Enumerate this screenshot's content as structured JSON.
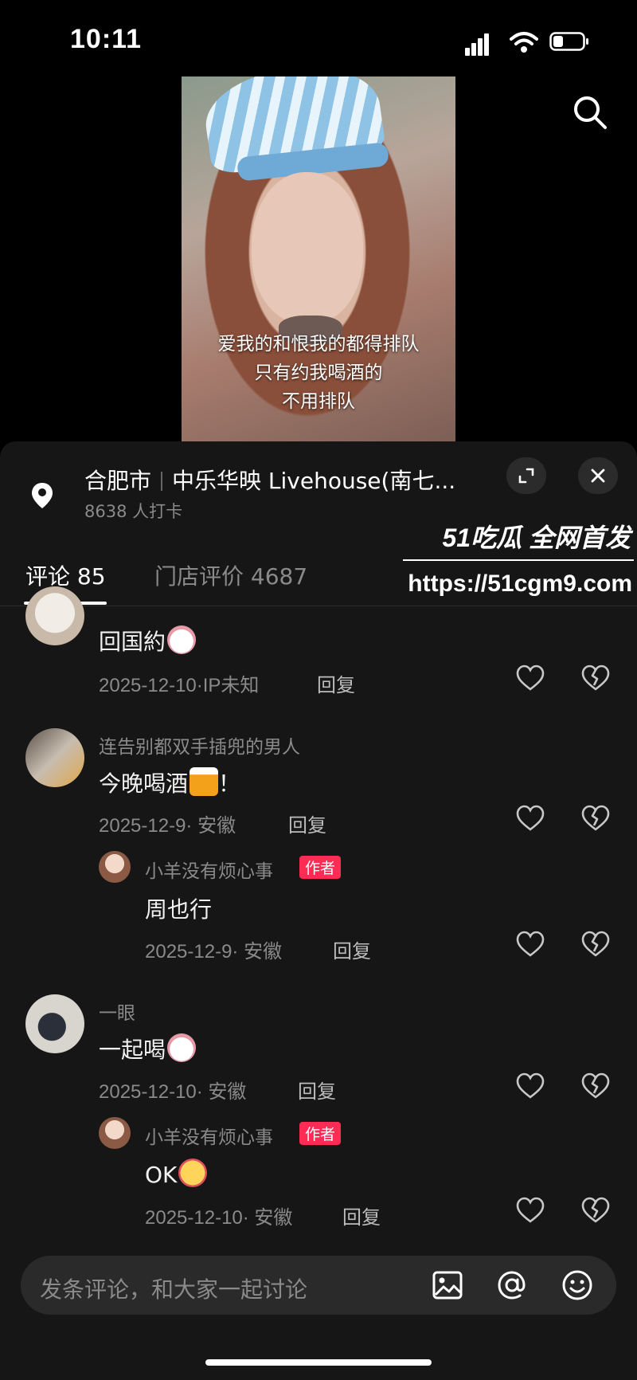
{
  "status_bar": {
    "time": "10:11"
  },
  "video": {
    "caption_lines": [
      "爱我的和恨我的都得排队",
      "只有约我喝酒的",
      "不用排队"
    ]
  },
  "location": {
    "city": "合肥市",
    "venue": "中乐华映 Livehouse(南七...",
    "checkins": "8638 人打卡"
  },
  "watermark": {
    "brand": "51吃瓜 全网首发",
    "url": "https://51cgm9.com"
  },
  "tabs": [
    {
      "label": "评论 85",
      "active": true
    },
    {
      "label": "门店评价 4687",
      "active": false
    }
  ],
  "comments": [
    {
      "username": "",
      "text": "回国約",
      "emoji": "cat-face-emoji",
      "meta": "2025-12-10·IP未知",
      "reply": "回复"
    },
    {
      "username": "连告别都双手插兜的男人",
      "text": "今晚喝酒",
      "emoji_after": "beer-mug-emoji",
      "suffix": "！",
      "meta": "2025-12-9· 安徽",
      "reply": "回复",
      "replies": [
        {
          "username": "小羊没有烦心事",
          "badge": "作者",
          "text": "周也行",
          "meta": "2025-12-9· 安徽",
          "reply": "回复"
        }
      ]
    },
    {
      "username": "一眼",
      "text": "一起喝",
      "emoji": "cat-face-emoji",
      "meta": "2025-12-10· 安徽",
      "reply": "回复",
      "replies": [
        {
          "username": "小羊没有烦心事",
          "badge": "作者",
          "text": "OK",
          "emoji": "kiss-face-emoji",
          "meta": "2025-12-10· 安徽",
          "reply": "回复"
        }
      ]
    }
  ],
  "input": {
    "placeholder": "发条评论，和大家一起讨论"
  },
  "colors": {
    "background": "#000000",
    "sheet": "#161616",
    "author_badge": "#fe2c55",
    "muted_text": "#8a8a8a"
  }
}
